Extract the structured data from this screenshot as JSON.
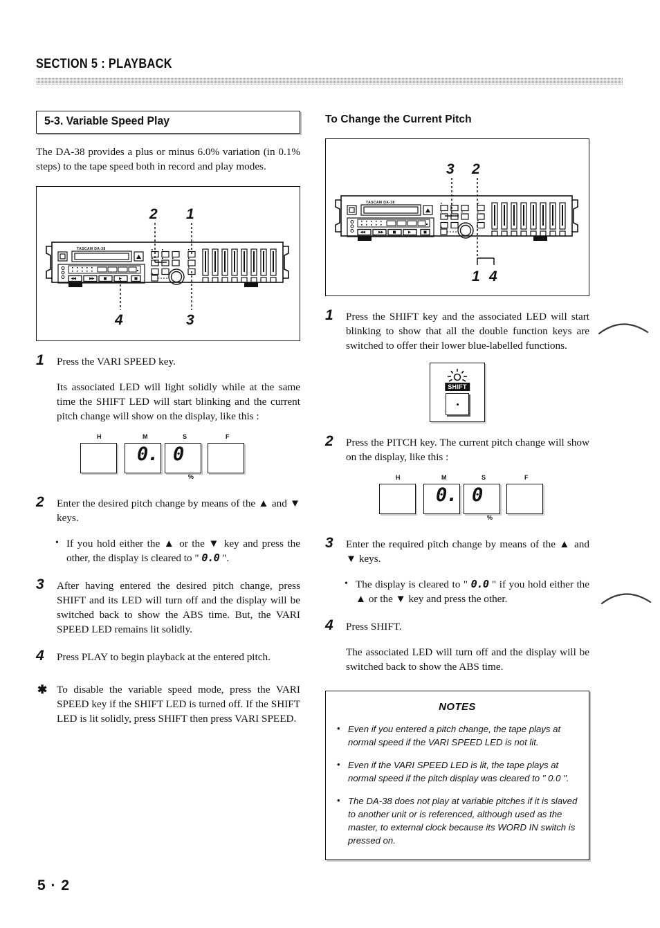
{
  "header": {
    "section": "SECTION 5 :  PLAYBACK"
  },
  "folio": "5 · 2",
  "left_column": {
    "title": "5-3. Variable Speed Play",
    "intro": "The DA-38 provides a plus or minus 6.0% variation (in 0.1% steps) to the tape speed both in record and play modes.",
    "figure": {
      "name": "da38-front-panel",
      "brand": "TASCAM DA-38",
      "callouts": [
        "2",
        "1",
        "4",
        "3"
      ]
    },
    "steps": [
      {
        "num": "1",
        "text": "Press the VARI SPEED key.",
        "sub": "Its associated LED will light solidly while at the same time the SHIFT LED will start blinking and the current pitch change will show on the display, like this :"
      },
      {
        "num": "2",
        "text": "Enter the desired pitch change by means of the ▲ and ▼ keys."
      },
      {
        "num": "3",
        "text": "After having entered the desired pitch change, press SHIFT and its LED will turn off and the display will be switched back to show the ABS time. But, the VARI SPEED LED remains lit solidly."
      },
      {
        "num": "4",
        "text": "Press PLAY to begin playback at the entered pitch."
      }
    ],
    "bullet_1_pre": "If you hold either the ▲ or the ▼ key and press the other, the display is cleared to \" ",
    "bullet_1_lcd": "0.0",
    "bullet_1_post": " \".",
    "starnote": {
      "star": "✱",
      "text": "To disable the variable speed mode, press the VARI SPEED key if the SHIFT LED is turned off. If the SHIFT LED is lit solidly, press SHIFT then press VARI SPEED."
    },
    "display": {
      "captions": [
        "H",
        "M",
        "S",
        "F"
      ],
      "digits": [
        "",
        "0.",
        "0",
        ""
      ],
      "unit": "%"
    }
  },
  "right_column": {
    "title": "To Change the Current Pitch",
    "figure": {
      "name": "da38-front-panel",
      "brand": "TASCAM DA-38",
      "callouts": [
        "3",
        "2",
        "1",
        "4"
      ]
    },
    "steps": [
      {
        "num": "1",
        "text": "Press the SHIFT key and the associated LED will start blinking to show that all the double function keys are switched to offer their lower blue-labelled functions."
      },
      {
        "num": "2",
        "text": "Press the PITCH key. The current pitch change will show on the display, like this :"
      },
      {
        "num": "3",
        "text": "Enter the required pitch change by means of the ▲ and ▼ keys."
      },
      {
        "num": "4",
        "text": "Press SHIFT.",
        "sub": "The associated LED will turn off and the display will be switched back to show the ABS time."
      }
    ],
    "bullet_1_pre": "The display is cleared to \" ",
    "bullet_1_lcd": "0.0",
    "bullet_1_post": " \" if you hold either the ▲ or the ▼ key and press the other.",
    "shift_figure": {
      "label": "SHIFT",
      "icon": "blinking-led-burst"
    },
    "display": {
      "captions": [
        "H",
        "M",
        "S",
        "F"
      ],
      "digits": [
        "",
        "0.",
        "0",
        ""
      ],
      "unit": "%"
    },
    "notes": {
      "heading": "NOTES",
      "items": [
        "Even if you entered a pitch change, the tape plays at normal speed if the VARI SPEED LED is not lit.",
        "Even if the VARI SPEED LED is lit, the tape plays at normal speed if the pitch display was cleared to \" 0.0 \".",
        "The DA-38 does not play at variable pitches if it is slaved to another unit or is referenced, although used as the master, to external clock because its WORD IN switch is pressed on."
      ]
    }
  }
}
